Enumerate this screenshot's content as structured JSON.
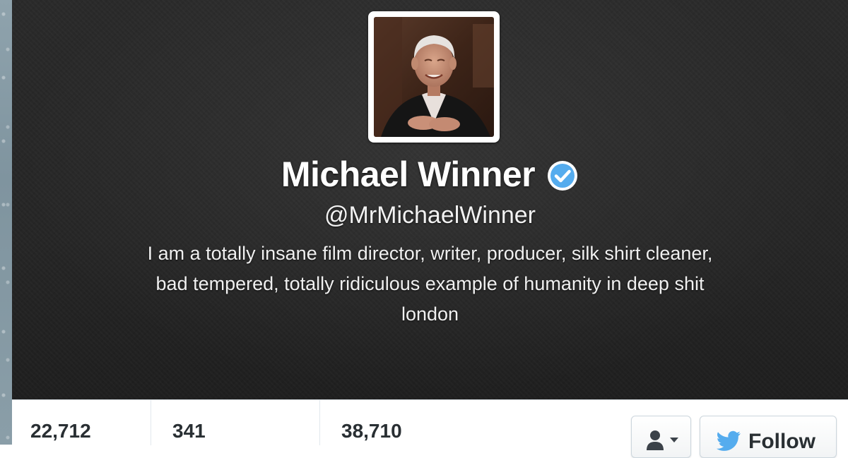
{
  "profile": {
    "name": "Michael Winner",
    "handle": "@MrMichaelWinner",
    "bio": [
      "I am a totally insane film director, writer, producer, silk shirt cleaner,",
      "bad tempered, totally ridiculous example of humanity in deep shit"
    ],
    "location": "london",
    "verified": true
  },
  "stats": {
    "tweets": "22,712",
    "following": "341",
    "followers": "38,710"
  },
  "actions": {
    "user_menu_icon": "user-dropdown-icon",
    "follow_label": "Follow",
    "follow_icon": "bird-icon"
  },
  "colors": {
    "verified_badge": "#55acee",
    "bird": "#55acee",
    "header_bg": "#262626"
  }
}
